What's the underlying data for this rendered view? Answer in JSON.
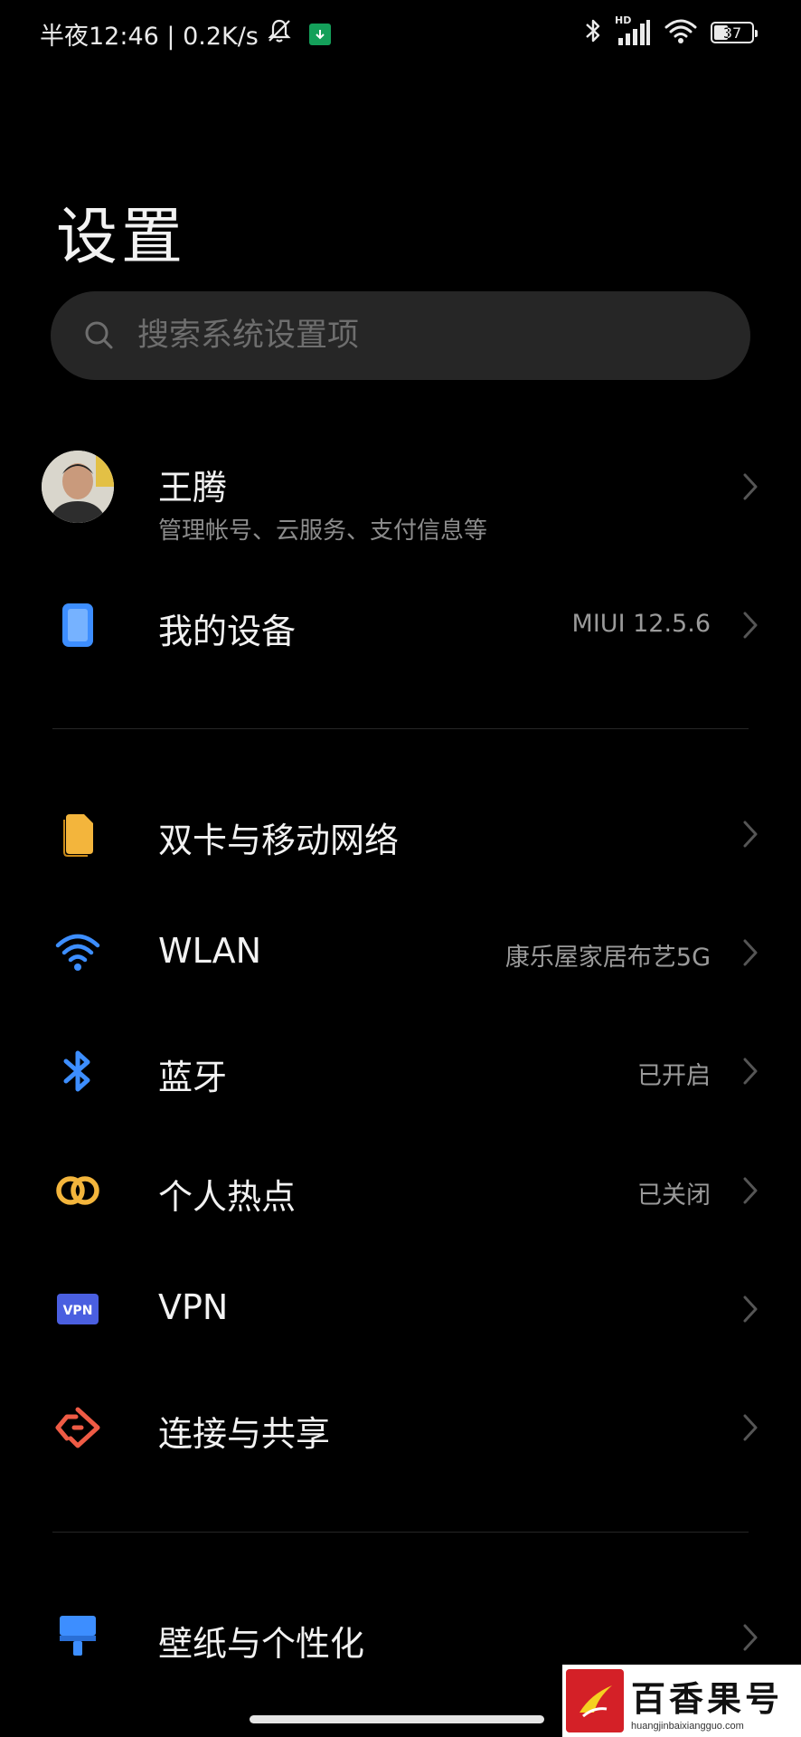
{
  "status_bar": {
    "time_speed": "半夜12:46 | 0.2K/s",
    "signal_tag": "HD",
    "battery_level": "37",
    "battery_fraction": 0.37
  },
  "page": {
    "title": "设置"
  },
  "search": {
    "placeholder": "搜索系统设置项"
  },
  "account": {
    "name": "王腾",
    "subtitle": "管理帐号、云服务、支付信息等"
  },
  "device": {
    "label": "我的设备",
    "value": "MIUI 12.5.6"
  },
  "network_items": [
    {
      "label": "双卡与移动网络",
      "value": "",
      "icon": "sim-card-icon",
      "color": "#f3b53c"
    },
    {
      "label": "WLAN",
      "value": "康乐屋家居布艺5G",
      "icon": "wifi-icon",
      "color": "#3d8eff"
    },
    {
      "label": "蓝牙",
      "value": "已开启",
      "icon": "bluetooth-icon",
      "color": "#3d8eff"
    },
    {
      "label": "个人热点",
      "value": "已关闭",
      "icon": "hotspot-icon",
      "color": "#f3b53c"
    },
    {
      "label": "VPN",
      "value": "",
      "icon": "vpn-icon",
      "color": "#4a5fe0"
    },
    {
      "label": "连接与共享",
      "value": "",
      "icon": "connection-share-icon",
      "color": "#ef5b45"
    }
  ],
  "personalization_items": [
    {
      "label": "壁纸与个性化",
      "value": "",
      "icon": "wallpaper-icon",
      "color": "#3d8eff"
    }
  ],
  "watermark": {
    "name": "百香果号",
    "url": "huangjinbaixiangguo.com"
  }
}
